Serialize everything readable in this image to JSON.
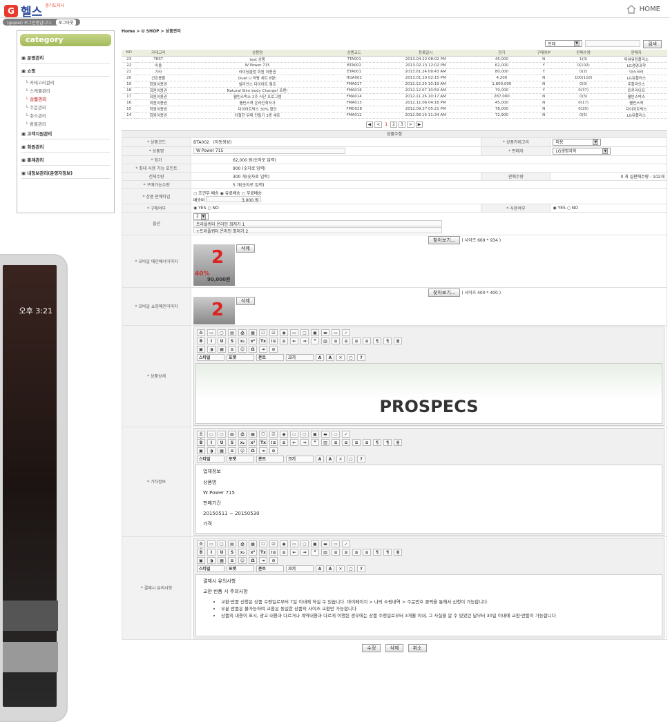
{
  "header": {
    "logo_mark": "G",
    "logo_text": "헬스",
    "logo_sub": "경기도지사",
    "home_label": "HOME"
  },
  "userbar": {
    "user": "(goplei) 로그인중입니다.",
    "logout": "로그아웃"
  },
  "sidebar": {
    "title": "category",
    "groups": [
      {
        "label": "운영관리",
        "items": []
      },
      {
        "label": "쇼핑",
        "items": [
          {
            "label": "카테고리관리",
            "on": false
          },
          {
            "label": "스케쥴관리",
            "on": false
          },
          {
            "label": "상품관리",
            "on": true
          },
          {
            "label": "주문관리",
            "on": false
          },
          {
            "label": "취소관리",
            "on": false
          },
          {
            "label": "환불관리",
            "on": false
          }
        ]
      },
      {
        "label": "고객지원관리",
        "items": []
      },
      {
        "label": "회원관리",
        "items": []
      },
      {
        "label": "통계관리",
        "items": []
      },
      {
        "label": "내정보관리(운영자정보)",
        "items": []
      }
    ]
  },
  "phone": {
    "time": "오후 3:21"
  },
  "breadcrumb": "Home > U SHOP > 상품관리",
  "search": {
    "filter": "전체",
    "button": "검색"
  },
  "list": {
    "headers": [
      "NO",
      "카테고리",
      "상품명",
      "상품코드",
      "등록일시",
      "정가",
      "구매여부",
      "판매수량",
      "판매자"
    ],
    "rows": [
      [
        "23",
        "TEST",
        "test 상품",
        "TTA001",
        "2013.04.22 08:02 PM",
        "45,000",
        "N",
        "1(0)",
        "파워워킹플러스"
      ],
      [
        "22",
        "미용",
        "W Power 715",
        "BTA002",
        "2013.02.13 12:02 PM",
        "62,000",
        "Y",
        "0(102)",
        "LG생명과학"
      ],
      [
        "21",
        "기타",
        "라이딩클럽 회원 이용권",
        "ETA001",
        "2013.01.24 09:43 AM",
        "80,000",
        "Y",
        "0(2)",
        "아스크라"
      ],
      [
        "20",
        "건강용품",
        "Duet U 마왕 세트 8형!",
        "HGA002",
        "2013.01.10 02:15 PM",
        "4,200",
        "N",
        "100(118)",
        "LG유플러스"
      ],
      [
        "19",
        "회원이용권",
        "빌리언스 다이어트 캠프",
        "FMA017",
        "2012.12.20 10:19 AM",
        "1,800,000",
        "N",
        "0(0)",
        "주할라인스"
      ],
      [
        "18",
        "회원이용권",
        "Natural Slim body Change! 프렌!",
        "FMA016",
        "2012.12.07 10:59 AM",
        "70,000",
        "Y",
        "0(37)",
        "트루라이프"
      ],
      [
        "17",
        "회원이용권",
        "웰빈스박스 2주 식단 프로그램",
        "FMA014",
        "2012.11.26 10:17 AM",
        "287,000",
        "N",
        "0(3)",
        "웰빈스박스"
      ],
      [
        "16",
        "회원이용권",
        "웰빈스쿡 온라인최저가",
        "FMA013",
        "2012.11.06 04:18 PM",
        "45,000",
        "N",
        "0(17)",
        "웰빈스쿡"
      ],
      [
        "15",
        "회원이용권",
        "다이어트박스 30% 할인",
        "FMD028",
        "2012.09.27 05:21 PM",
        "78,000",
        "N",
        "0(20)",
        "다이어트박스"
      ],
      [
        "14",
        "회원이용권",
        "아철한 뒤태 만들기 3종 세트",
        "FMA012",
        "2012.08.16 11:34 AM",
        "72,900",
        "N",
        "0(5)",
        "LG유플러스"
      ]
    ]
  },
  "pager": {
    "first": "◀",
    "prev": "<",
    "pages": [
      "1",
      "2",
      "3"
    ],
    "next": ">",
    "last": "▶"
  },
  "form": {
    "title": "상품수정",
    "code_label": "* 상품코드",
    "code": "BTA002",
    "code_note": "(자동생성)",
    "cat_label": "* 상품카테고리",
    "cat": "미용",
    "name_label": "* 상품명",
    "name": "W Power 715",
    "seller_label": "* 판매자",
    "seller": "LG생명과학",
    "price_label": "* 정가",
    "price": "62,000 원(숫자로 입력)",
    "point_label": "* 최대 사용 가능 포인트",
    "point": "900 (숫자로 입력)",
    "stock_label": "전체수량",
    "stock": "300 개(숫자로 입력)",
    "sold_label": "판매수량",
    "sold": "0 개 실판매수량 : 102개",
    "buyable_label": "* 구매가능수량",
    "buyable": "5 개(숫자로 입력)",
    "ship_label": "* 상품 판매타입",
    "ship_opts": "○ 조건부 배송  ◉ 유료배송  ○ 무료배송",
    "ship_fee_label": "배송비",
    "ship_fee": "3,000 원",
    "buy_label": "* 구매여부",
    "buy_opts": "◉ YES  ○ NO",
    "use_label": "* 사용여부",
    "use_opts": "◉ YES  ○ NO",
    "option_label": "옵션",
    "option_count": "2",
    "option1": "트라플퀴터 온라인 최저가 1",
    "option2": "+트라플퀴터 온라인 최저가 2",
    "banner_label": "* 모바일 메인배너이미지",
    "browse": "찾아보기...",
    "banner_size": "( 사이즈 669 * 934 )",
    "delete": "삭제",
    "banner_price": "90,000원",
    "banner_discount": "40%",
    "shopimg_label": "* 모바일 쇼핑메인이미지",
    "shopimg_size": "( 사이즈 400 * 400 )",
    "detail_label": "* 상품상세",
    "detail_brand": "PROSPECS",
    "etc_label": "* 기타정보",
    "etc_lines": [
      "업체정보",
      "상품명",
      "W Power 715",
      "판매기간",
      "20150511 ~ 20150530",
      "가격"
    ],
    "notice_label": "* 결제시 유의사항",
    "notice_title": "결제시 유의사항",
    "notice_sub": "교환 반품 시 주의사항",
    "notice_items": [
      "교환·반품 신청은 상품 수령일로부터 7일 이내에 하실 수 있습니다. 마이페이지 > 나의 쇼핑내역 > 주문번호 클릭을 통해서 신청이 가능합니다.",
      "부분 반품은 불가능하며 교환은 동일한 상품의 사이즈 교환만 가능합니다",
      "상품의 내용이 표시, 광고 내용과 다르거나 계약내용과 다르게 이행된 경우에는 상품 수령일로부터 3개월 이내, 그 사실을 알 수 있었던 날부터 30일 이내에 교환·반품이 가능합니다"
    ]
  },
  "toolbar": {
    "row1": [
      "소스",
      "▭",
      "▢",
      "▤",
      "⎙",
      "▦",
      "☐",
      "☑",
      "◉",
      "▭",
      "▢",
      "▣",
      "▬",
      "▭",
      "✓"
    ],
    "row2": [
      "B",
      "I",
      "U",
      "S",
      "x₂",
      "x²",
      "Tx",
      "⁝≡",
      "≡",
      "⇤",
      "⇥",
      "❞",
      "▥",
      "≡",
      "≡",
      "≡",
      "≡",
      "¶",
      "¶",
      "≣"
    ],
    "row3": [
      "▣",
      "◑",
      "▦",
      "≡",
      "☺",
      "Ω",
      "⇥",
      "⊘"
    ],
    "row4": [
      "스타일",
      "포맷",
      "폰트",
      "크기",
      "A",
      "A",
      "✕",
      "▢",
      "?"
    ]
  },
  "buttons": {
    "edit": "수정",
    "delete": "삭제",
    "cancel": "취소"
  }
}
